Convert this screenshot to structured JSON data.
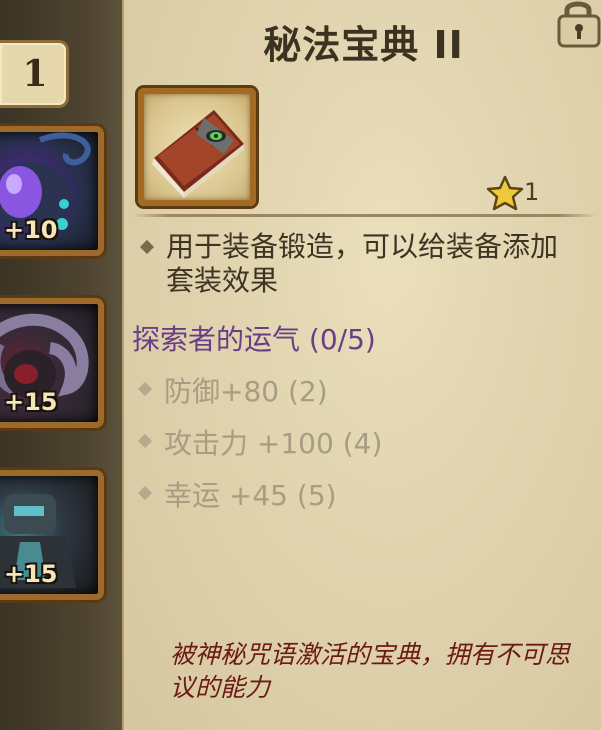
{
  "sidebar": {
    "page_number": "1",
    "slots": [
      {
        "level": "+10",
        "icon": "purple-orb-pouch-icon"
      },
      {
        "level": "+15",
        "icon": "ram-horn-helmet-icon"
      },
      {
        "level": "+15",
        "icon": "dark-armor-icon"
      }
    ]
  },
  "item": {
    "title": "秘法宝典 II",
    "icon": "arcane-tome-icon",
    "star_count": "1",
    "description": "用于装备锻造，可以给装备添加套装效果",
    "set_name": "探索者的运气 (0/5)",
    "set_bonuses": [
      "防御+80 (2)",
      "攻击力 +100 (4)",
      "幸运 +45 (5)"
    ],
    "lore": "被神秘咒语激活的宝典，拥有不可思议的能力"
  },
  "colors": {
    "set_name": "#6a3e86",
    "inactive_bonus": "#a89c82",
    "lore": "#6b1a14",
    "frame": "#a26a22"
  }
}
